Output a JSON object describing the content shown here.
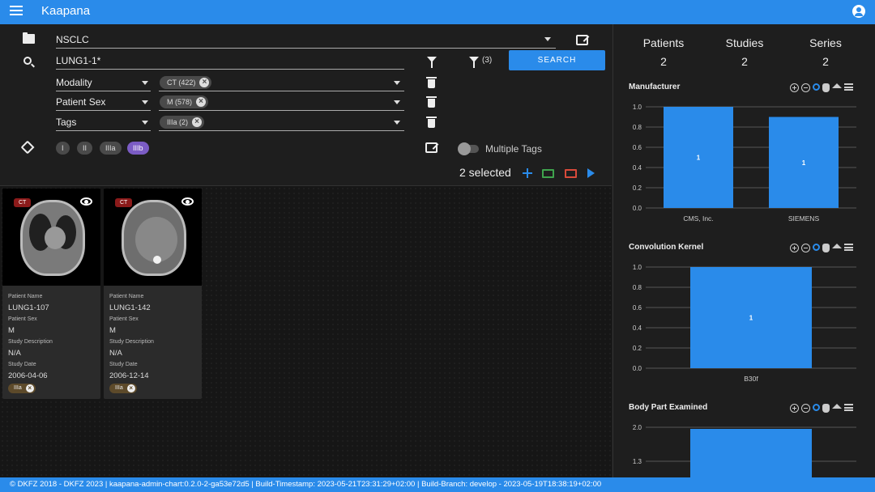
{
  "app": {
    "title": "Kaapana"
  },
  "filters": {
    "project": "NSCLC",
    "search_query": "LUNG1-1*",
    "filter_count": "(3)",
    "search_button": "SEARCH",
    "rows": [
      {
        "key": "Modality",
        "chip": "CT (422)"
      },
      {
        "key": "Patient Sex",
        "chip": "M (578)"
      },
      {
        "key": "Tags",
        "chip": "IIIa (2)"
      }
    ],
    "tags": [
      "I",
      "II",
      "IIIa",
      "IIIb"
    ],
    "selected_tag": "IIIb",
    "multiple_tags_label": "Multiple Tags"
  },
  "selection": {
    "text": "2 selected"
  },
  "cards": [
    {
      "modality": "CT",
      "fields": [
        {
          "label": "Patient Name",
          "value": "LUNG1-107"
        },
        {
          "label": "Patient Sex",
          "value": "M"
        },
        {
          "label": "Study Description",
          "value": "N/A"
        },
        {
          "label": "Study Date",
          "value": "2006-04-06"
        }
      ],
      "tag": "IIIa"
    },
    {
      "modality": "CT",
      "fields": [
        {
          "label": "Patient Name",
          "value": "LUNG1-142"
        },
        {
          "label": "Patient Sex",
          "value": "M"
        },
        {
          "label": "Study Description",
          "value": "N/A"
        },
        {
          "label": "Study Date",
          "value": "2006-12-14"
        }
      ],
      "tag": "IIIa"
    }
  ],
  "stats": [
    {
      "label": "Patients",
      "value": "2"
    },
    {
      "label": "Studies",
      "value": "2"
    },
    {
      "label": "Series",
      "value": "2"
    }
  ],
  "chart_data": [
    {
      "type": "bar",
      "title": "Manufacturer",
      "categories": [
        "CMS, Inc.",
        "SIEMENS"
      ],
      "values": [
        1,
        0.9
      ],
      "data_labels": [
        "1",
        "1"
      ],
      "yticks": [
        "1.0",
        "0.8",
        "0.6",
        "0.4",
        "0.2",
        "0.0"
      ],
      "ylim": [
        0,
        1.0
      ],
      "color": "#2a8bea"
    },
    {
      "type": "bar",
      "title": "Convolution Kernel",
      "categories": [
        "B30f"
      ],
      "values": [
        1
      ],
      "data_labels": [
        "1"
      ],
      "yticks": [
        "1.0",
        "0.8",
        "0.6",
        "0.4",
        "0.2",
        "0.0"
      ],
      "ylim": [
        0,
        1.0
      ],
      "color": "#2a8bea"
    },
    {
      "type": "bar",
      "title": "Body Part Examined",
      "categories": [
        ""
      ],
      "values": [
        2
      ],
      "data_labels": [],
      "yticks": [
        "2.0",
        "1.3"
      ],
      "ylim": [
        0,
        2.0
      ],
      "color": "#2a8bea"
    }
  ],
  "footer": {
    "text": "© DKFZ 2018 - DKFZ 2023 | kaapana-admin-chart:0.2.0-2-ga53e72d5 | Build-Timestamp: 2023-05-21T23:31:29+02:00 | Build-Branch: develop - 2023-05-19T18:38:19+02:00"
  },
  "colors": {
    "primary": "#2a8bea",
    "tag_selected": "#7b5cc4",
    "ct_badge": "#8b1a1a",
    "folder_add": "#3fa34d",
    "folder_remove": "#d94a3a"
  }
}
